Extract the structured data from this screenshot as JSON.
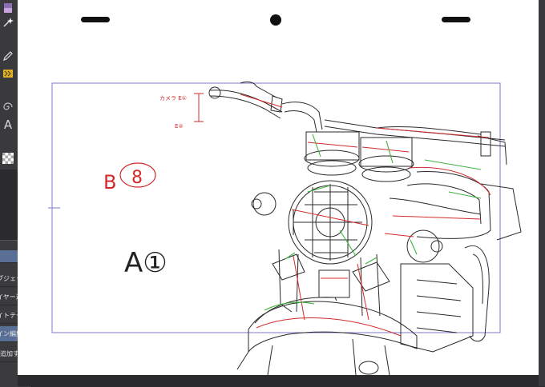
{
  "toolbar": {
    "tools": [
      {
        "icon": "gradient-tool-icon"
      },
      {
        "icon": "magic-wand-icon"
      },
      {
        "icon": "pen-icon"
      },
      {
        "icon": "ruler-tool-icon"
      },
      {
        "icon": "spiral-tool-icon"
      },
      {
        "icon": "text-tool-icon",
        "glyph": "A"
      },
      {
        "icon": "transparent-checker-icon"
      }
    ]
  },
  "side_panel": {
    "items": [
      {
        "label": "オブジェクト",
        "selected": false
      },
      {
        "label": "レイヤー選択",
        "selected": false
      },
      {
        "label": "ライトテーブル",
        "selected": false
      },
      {
        "label": "ライン編集",
        "selected": true
      },
      {
        "label": "追加する",
        "selected": false
      }
    ]
  },
  "canvas": {
    "annotations": {
      "note_top": "カメラ E①",
      "note_end": "E②",
      "cel_b": "B",
      "cel_b_num": "8",
      "cel_a": "A①"
    },
    "colors": {
      "frame": "#7a7ac8",
      "sketch": "#2a2a2a",
      "red_line": "#d42a2a",
      "green_line": "#3cb43c",
      "paper": "#ffffff",
      "ui_dark": "#3a3a3d",
      "selection": "#5a6f96"
    }
  }
}
